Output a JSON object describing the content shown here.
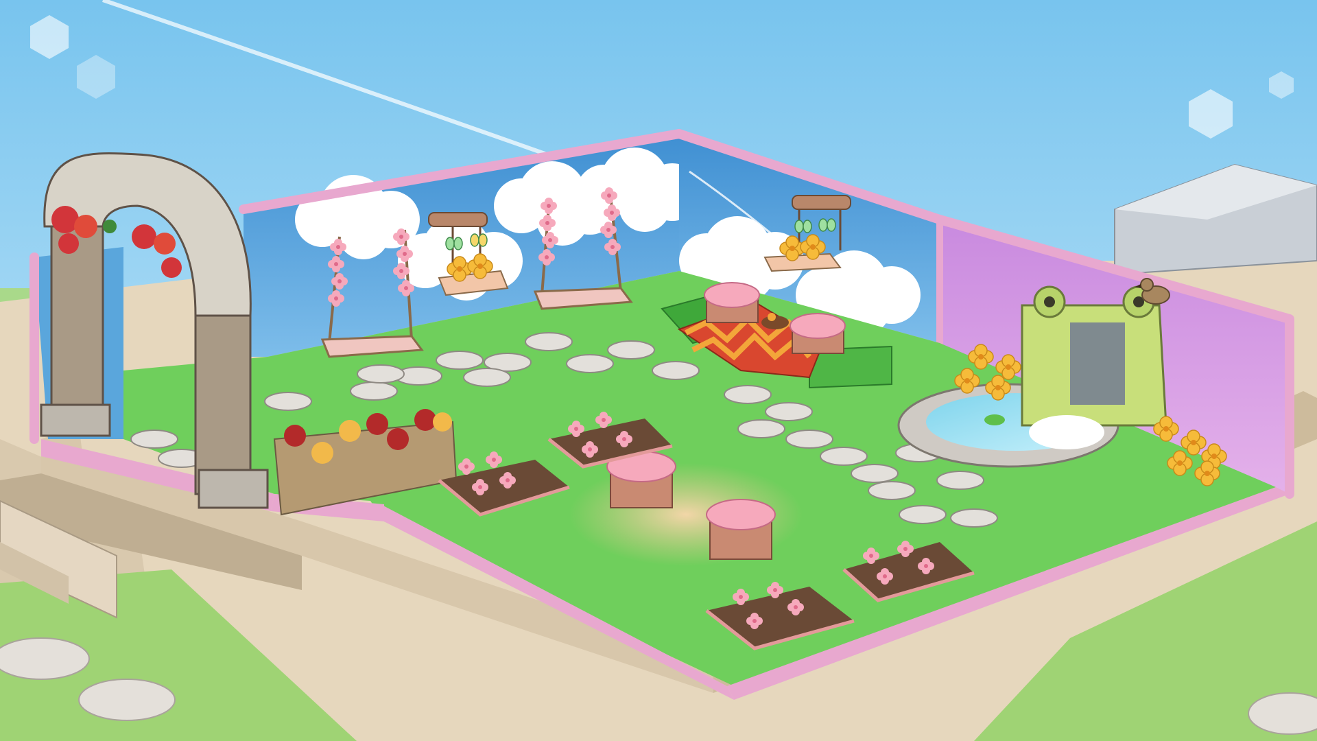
{
  "scene": {
    "kind": "isometric garden room",
    "colors": {
      "sky_top": "#7ec8ee",
      "sky_bottom": "#d6eefb",
      "grass": "#6fce5a",
      "grass_dark": "#4fae3f",
      "wall_blue": "#4f9fd8",
      "wall_pink_trim": "#e8a8cf",
      "wall_purple": "#cf8fe0",
      "ground_beige": "#e8d8c0",
      "stone": "#dcd9d4",
      "blossom": "#f4a7b9",
      "flower_yellow": "#f5b93b",
      "flower_red": "#c8283a"
    },
    "objects": {
      "arch": "stone-arch",
      "swings": [
        "flower-swing",
        "flower-swing"
      ],
      "hanging_planters": [
        "butterfly-planter",
        "butterfly-planter"
      ],
      "picnic": "picnic-blanket",
      "stumps": [
        "blossom-stump",
        "blossom-stump",
        "blossom-stump",
        "blossom-stump"
      ],
      "planter_box": "pansy-planter",
      "flower_beds": [
        "flower-bed",
        "flower-bed",
        "flower-bed",
        "flower-bed"
      ],
      "pond": "fountain-pond",
      "bird": "sparrow"
    }
  }
}
